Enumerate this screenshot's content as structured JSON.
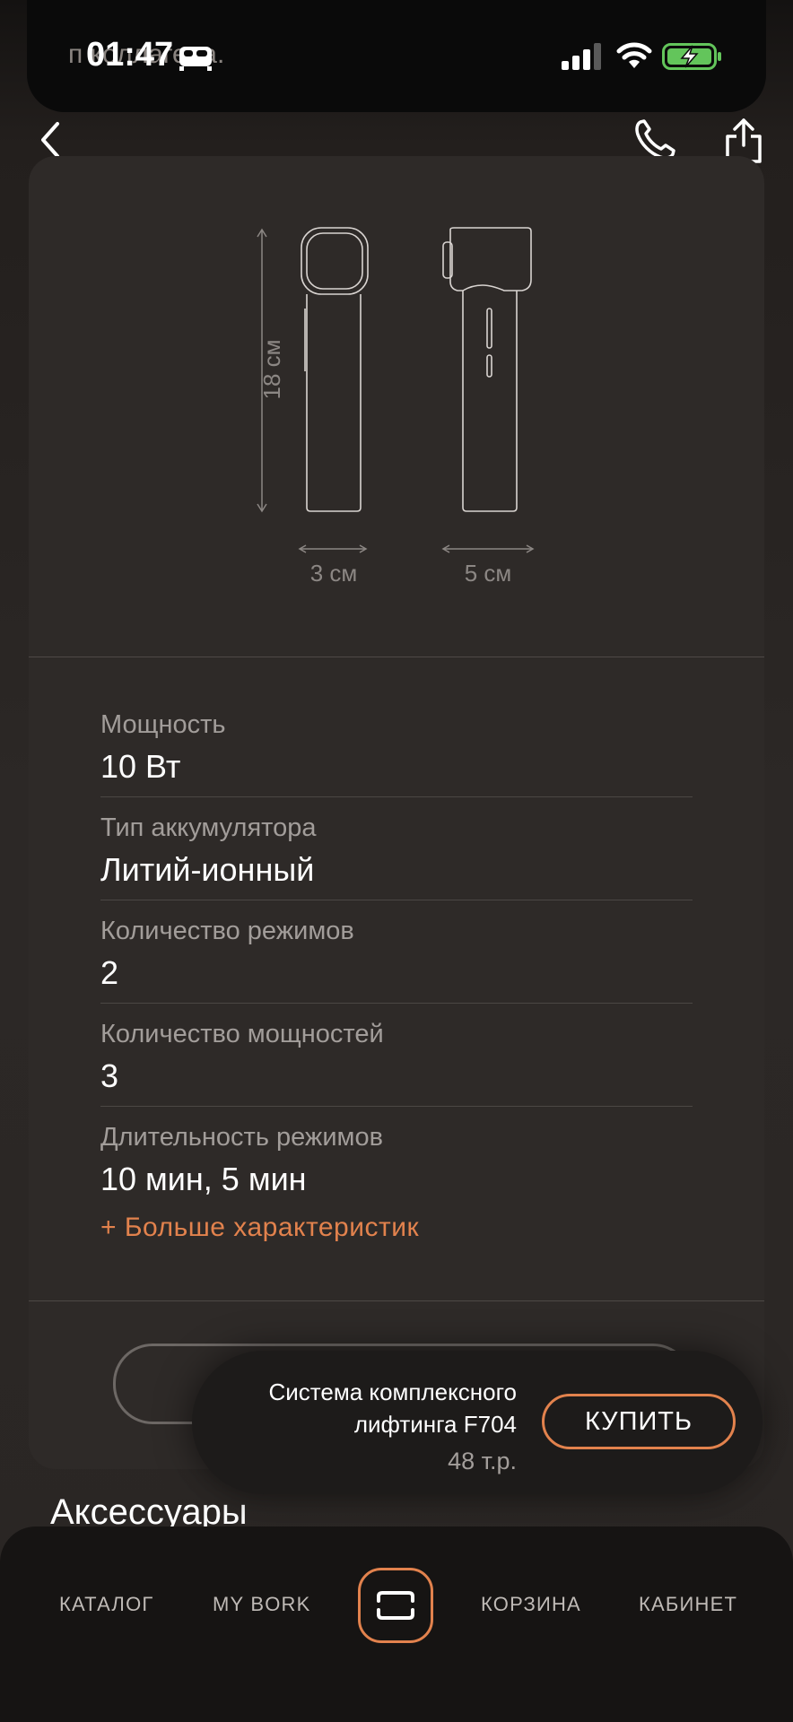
{
  "status_bar": {
    "behind_text": "п   коллагена.",
    "time": "01:47",
    "battery_color": "#63c55b"
  },
  "navigation": {
    "back_icon": "chevron-left-icon",
    "phone_icon": "phone-icon",
    "share_icon": "share-icon"
  },
  "dimensions": {
    "height_label": "18 см",
    "width_front_label": "3 см",
    "width_side_label": "5 см"
  },
  "specs": [
    {
      "label": "Мощность",
      "value": "10 Вт"
    },
    {
      "label": "Тип аккумулятора",
      "value": "Литий-ионный"
    },
    {
      "label": "Количество режимов",
      "value": "2"
    },
    {
      "label": "Количество мощностей",
      "value": "3"
    },
    {
      "label": "Длительность режимов",
      "value": "10 мин, 5 мин"
    }
  ],
  "more_specs_label": "+ Больше характеристик",
  "accessories_title": "Аксессуары",
  "buy_bar": {
    "product_name": "Система комплексного лифтинга F704",
    "price": "48 т.р.",
    "buy_label": "КУПИТЬ"
  },
  "tab_bar": {
    "catalog": "КАТАЛОГ",
    "my_bork": "MY BORK",
    "scan_icon": "scan-icon",
    "cart": "КОРЗИНА",
    "cabinet": "КАБИНЕТ"
  },
  "accent_color": "#e2824d"
}
